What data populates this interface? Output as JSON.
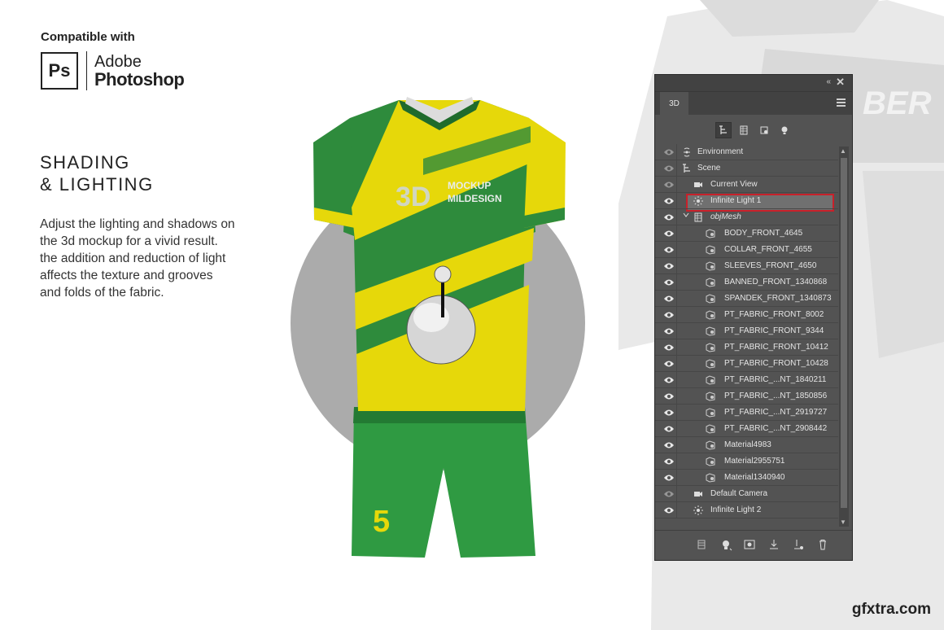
{
  "intro": {
    "compatible_label": "Compatible with",
    "ps_badge": "Ps",
    "ps_vendor": "Adobe",
    "ps_product": "Photoshop"
  },
  "feature": {
    "heading_line1": "SHADING",
    "heading_line2": "& LIGHTING",
    "description_lines": [
      "Adjust the lighting and shadows on",
      "the 3d mockup for a vivid result.",
      "the addition and reduction of light",
      "affects the texture and grooves",
      "and folds of the fabric."
    ]
  },
  "mockup": {
    "logo_line1": "3D",
    "logo_line2a": "MOCKUP",
    "logo_line2b": "MILDESIGN",
    "shorts_number": "5",
    "colors": {
      "green": "#2e8b3c",
      "yellow": "#e6d80a",
      "dark_green": "#1f6b2c"
    }
  },
  "panel": {
    "tab_label": "3D",
    "collapse_glyph": "«",
    "close_glyph": "✕",
    "selected_layer": "Infinite Light 1",
    "layers": [
      {
        "label": "Environment",
        "icon": "environment-icon",
        "visible": false
      },
      {
        "label": "Scene",
        "icon": "scene-icon",
        "visible": false
      },
      {
        "label": "Current View",
        "icon": "camera-icon",
        "visible": false
      },
      {
        "label": "Infinite Light 1",
        "icon": "light-icon",
        "visible": true
      },
      {
        "label": "objMesh",
        "icon": "mesh-icon",
        "visible": true
      },
      {
        "label": "BODY_FRONT_4645",
        "icon": "material-icon",
        "visible": true
      },
      {
        "label": "COLLAR_FRONT_4655",
        "icon": "material-icon",
        "visible": true
      },
      {
        "label": "SLEEVES_FRONT_4650",
        "icon": "material-icon",
        "visible": true
      },
      {
        "label": "BANNED_FRONT_1340868",
        "icon": "material-icon",
        "visible": true
      },
      {
        "label": "SPANDEK_FRONT_1340873",
        "icon": "material-icon",
        "visible": true
      },
      {
        "label": "PT_FABRIC_FRONT_8002",
        "icon": "material-icon",
        "visible": true
      },
      {
        "label": "PT_FABRIC_FRONT_9344",
        "icon": "material-icon",
        "visible": true
      },
      {
        "label": "PT_FABRIC_FRONT_10412",
        "icon": "material-icon",
        "visible": true
      },
      {
        "label": "PT_FABRIC_FRONT_10428",
        "icon": "material-icon",
        "visible": true
      },
      {
        "label": "PT_FABRIC_...NT_1840211",
        "icon": "material-icon",
        "visible": true
      },
      {
        "label": "PT_FABRIC_...NT_1850856",
        "icon": "material-icon",
        "visible": true
      },
      {
        "label": "PT_FABRIC_...NT_2919727",
        "icon": "material-icon",
        "visible": true
      },
      {
        "label": "PT_FABRIC_...NT_2908442",
        "icon": "material-icon",
        "visible": true
      },
      {
        "label": "Material4983",
        "icon": "material-icon",
        "visible": true
      },
      {
        "label": "Material2955751",
        "icon": "material-icon",
        "visible": true
      },
      {
        "label": "Material1340940",
        "icon": "material-icon",
        "visible": true
      },
      {
        "label": "Default Camera",
        "icon": "camera-icon",
        "visible": false
      },
      {
        "label": "Infinite Light 2",
        "icon": "light-icon",
        "visible": true
      }
    ],
    "colors": {
      "panel_bg": "#535353",
      "selection_border": "#c8202a"
    }
  },
  "watermark": "gfxtra.com"
}
